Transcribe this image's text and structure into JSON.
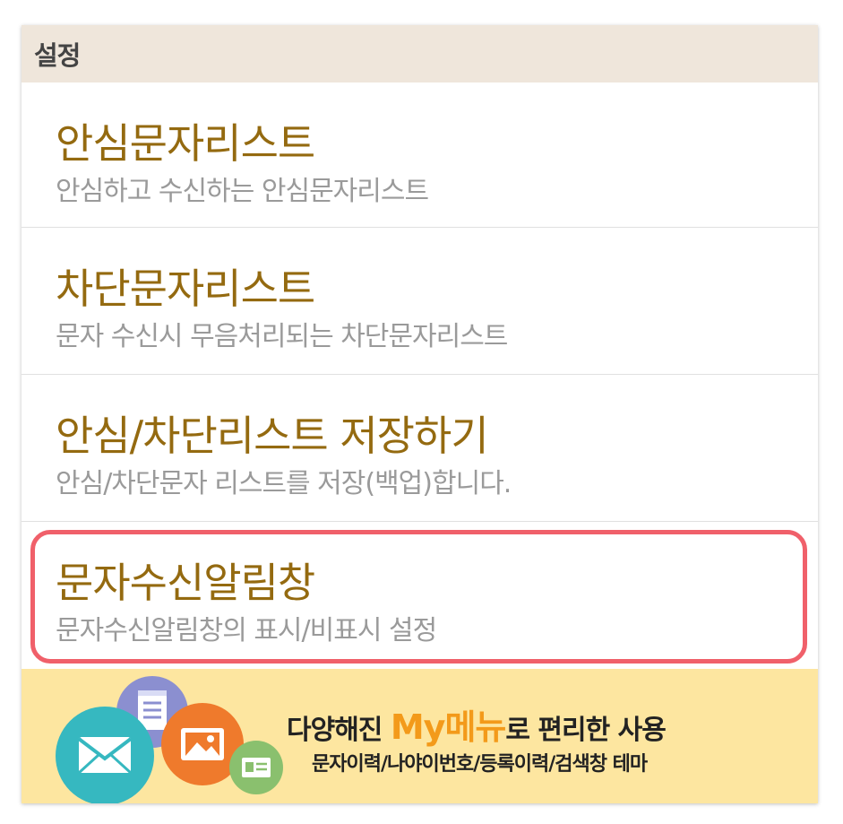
{
  "header": {
    "title": "설정"
  },
  "items": [
    {
      "title": "안심문자리스트",
      "desc": "안심하고 수신하는 안심문자리스트"
    },
    {
      "title": "차단문자리스트",
      "desc": "문자 수신시 무음처리되는 차단문자리스트"
    },
    {
      "title": "안심/차단리스트 저장하기",
      "desc": "안심/차단문자 리스트를 저장(백업)합니다."
    },
    {
      "title": "문자수신알림창",
      "desc": "문자수신알림창의 표시/비표시 설정"
    }
  ],
  "banner": {
    "line1_pre": "다양해진 ",
    "line1_accent": "My메뉴",
    "line1_post": "로 편리한 사용",
    "line2": "문자이력/나야이번호/등록이력/검색창 테마"
  },
  "colors": {
    "title": "#946a10",
    "desc": "#9a9a9a",
    "header_bg": "#efe6db",
    "highlight": "#f0606a",
    "banner_bg": "#fde6a0",
    "banner_accent": "#f39a1a"
  },
  "icons": [
    "notepad-icon",
    "mail-icon",
    "photo-icon",
    "contact-card-icon"
  ]
}
